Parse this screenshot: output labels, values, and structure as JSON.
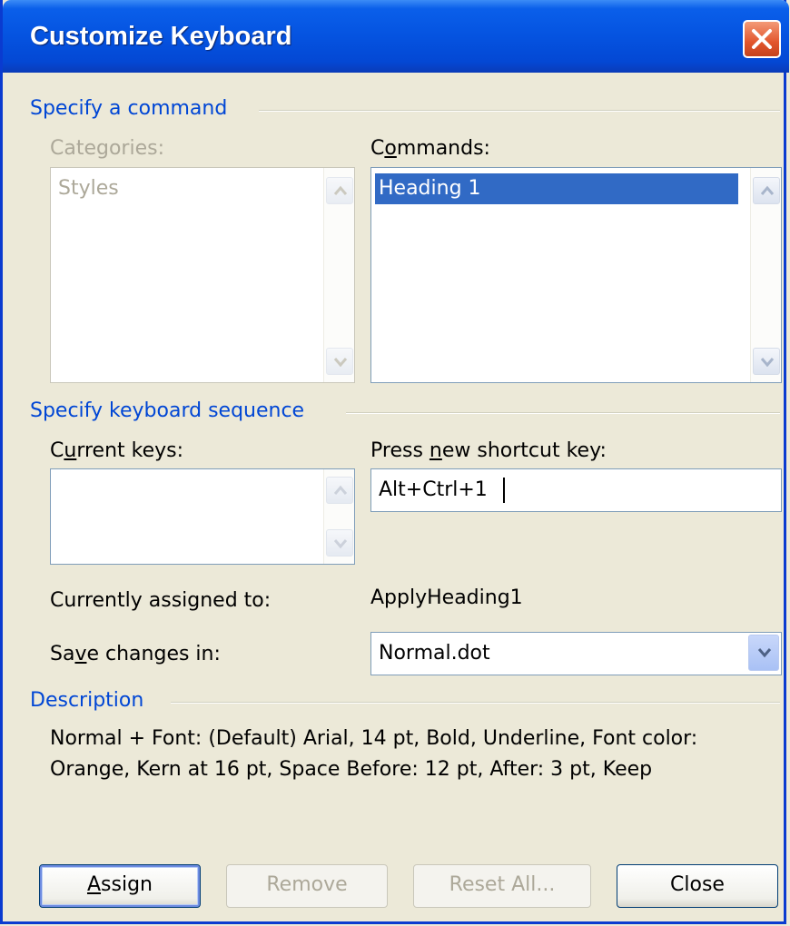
{
  "window": {
    "title": "Customize Keyboard",
    "close_icon": "close-icon"
  },
  "command_group": {
    "label": "Specify a command",
    "categories_label": "Categories:",
    "categories_items": [
      "Styles"
    ],
    "commands_label": "Commands:",
    "commands_items": [
      "Heading 1"
    ]
  },
  "keyboard_group": {
    "label": "Specify keyboard sequence",
    "current_keys_label": "Current keys:",
    "new_shortcut_label": "Press new shortcut key:",
    "new_shortcut_value": "Alt+Ctrl+1",
    "assigned_label": "Currently assigned to:",
    "assigned_value": "ApplyHeading1",
    "save_in_label": "Save changes in:",
    "save_in_value": "Normal.dot"
  },
  "description_group": {
    "label": "Description",
    "text": "Normal + Font: (Default) Arial, 14 pt, Bold, Underline, Font color: Orange, Kern at 16 pt, Space Before:  12 pt, After:  3 pt, Keep"
  },
  "buttons": {
    "assign": "Assign",
    "remove": "Remove",
    "reset_all": "Reset All...",
    "close": "Close"
  },
  "colors": {
    "title_bar": "#0553E0",
    "group_label": "#0046D5",
    "selection": "#316AC5",
    "close_button": "#E2552C"
  }
}
